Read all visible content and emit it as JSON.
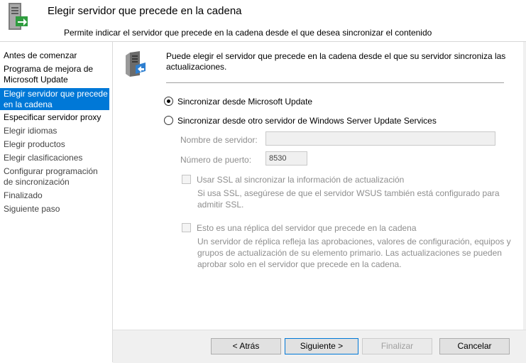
{
  "header": {
    "title": "Elegir servidor que precede en la cadena",
    "subtitle": "Permite indicar el servidor que precede en la cadena desde el que desea sincronizar el contenido",
    "icon": "server-sync-icon"
  },
  "sidebar": {
    "items": [
      {
        "label": "Antes de comenzar"
      },
      {
        "label": "Programa de mejora de Microsoft Update"
      },
      {
        "label": "Elegir servidor que precede en la cadena"
      },
      {
        "label": "Especificar servidor proxy"
      },
      {
        "label": "Elegir idiomas"
      },
      {
        "label": "Elegir productos"
      },
      {
        "label": "Elegir clasificaciones"
      },
      {
        "label": "Configurar programación de sincronización"
      },
      {
        "label": "Finalizado"
      },
      {
        "label": "Siguiente paso"
      }
    ],
    "active_index": 2
  },
  "main": {
    "icon": "server-update-icon",
    "intro": "Puede elegir el servidor que precede en la cadena desde el que su servidor sincroniza las actualizaciones.",
    "option_microsoft": "Sincronizar desde Microsoft Update",
    "option_wsus": "Sincronizar desde otro servidor de Windows Server Update Services",
    "server_name_label": "Nombre de servidor:",
    "server_name_value": "",
    "port_label": "Número de puerto:",
    "port_value": "8530",
    "ssl_label": "Usar SSL al sincronizar la información de actualización",
    "ssl_desc": "Si usa SSL, asegúrese de que el servidor WSUS también está configurado para admitir SSL.",
    "replica_label": "Esto es una réplica del servidor que precede en la cadena",
    "replica_desc": "Un servidor de réplica refleja las aprobaciones, valores de configuración, equipos y grupos de actualización de su elemento primario. Las actualizaciones se pueden aprobar solo en el servidor que precede en la cadena."
  },
  "footer": {
    "back": "< Atrás",
    "next": "Siguiente >",
    "finish": "Finalizar",
    "cancel": "Cancelar"
  },
  "colors": {
    "accent": "#0078d7",
    "disabled_text": "#8e8e8e"
  }
}
